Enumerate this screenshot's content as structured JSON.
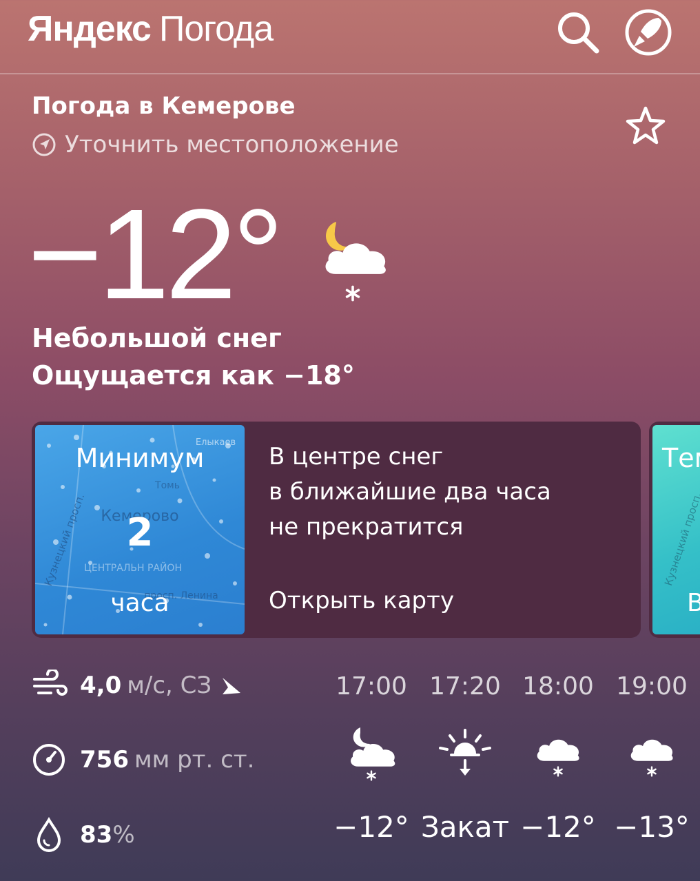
{
  "header": {
    "brand_bold": "Яндекс",
    "brand_light": "Погода"
  },
  "location": {
    "title": "Погода в Кемерове",
    "refine": "Уточнить местоположение"
  },
  "current": {
    "temp": "−12°",
    "condition": "Небольшой снег",
    "feels_like": "Ощущается как −18°",
    "icon": "moon-cloud-snow-icon"
  },
  "card": {
    "map_top": "Минимум",
    "map_num": "2",
    "map_bottom": "часа",
    "map_labels": {
      "city": "Кемерово",
      "district": "ЦЕНТРАЛЬН РАЙОН",
      "street": "Кузнецкий просп.",
      "avenue": "просп. Ленина",
      "river": "Томь",
      "place": "Елыкаев"
    },
    "message": "В центре снег\nв ближайшие два часа\nне прекратится",
    "link": "Открыть карту",
    "next_card_label": "Тем",
    "next_card_bottom": "В",
    "next_card_street": "Кузнецкий просп."
  },
  "stats": {
    "wind": {
      "value": "4,0",
      "unit": "м/с, СЗ"
    },
    "pressure": {
      "value": "756",
      "unit": "мм рт. ст."
    },
    "humidity": {
      "value": "83",
      "unit": "%"
    }
  },
  "hourly": [
    {
      "time": "17:00",
      "value": "−12°",
      "icon": "moon-cloud-snow-icon"
    },
    {
      "time": "17:20",
      "value": "Закат",
      "icon": "sunset-icon"
    },
    {
      "time": "18:00",
      "value": "−12°",
      "icon": "cloud-snow-icon"
    },
    {
      "time": "19:00",
      "value": "−13°",
      "icon": "cloud-snow-icon"
    }
  ]
}
